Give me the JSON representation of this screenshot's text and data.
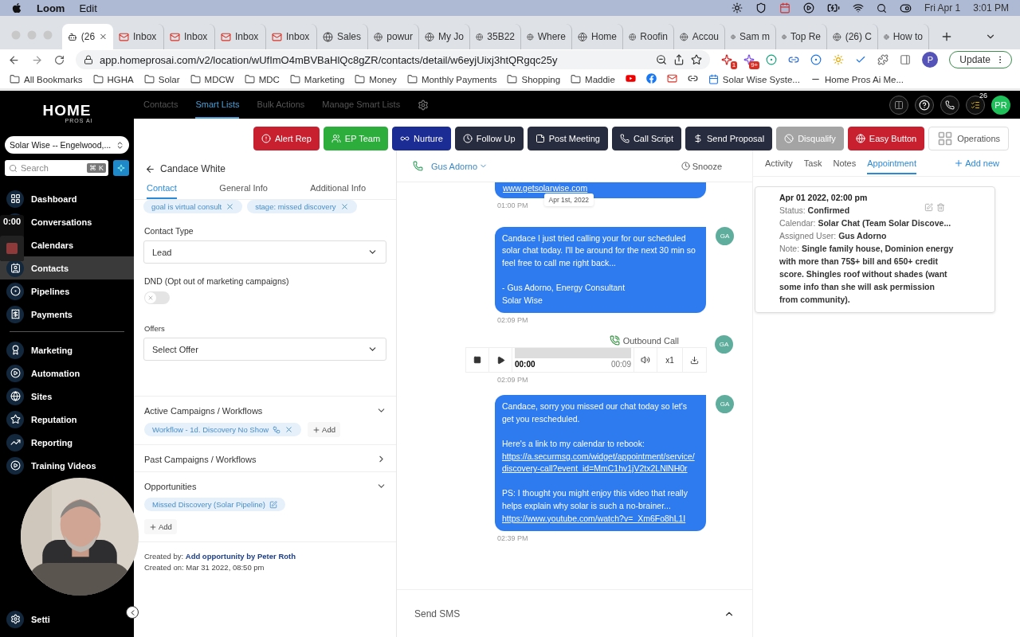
{
  "menu_bar": {
    "app": "Loom",
    "items": [
      "Edit"
    ],
    "date": "Fri Apr 1",
    "time": "3:01 PM"
  },
  "browser": {
    "tabs": [
      {
        "label": "(26",
        "selected": true
      },
      {
        "label": "Inbox",
        "selected": false
      },
      {
        "label": "Inbox",
        "selected": false
      },
      {
        "label": "Inbox",
        "selected": false
      },
      {
        "label": "Inbox",
        "selected": false
      },
      {
        "label": "Sales",
        "selected": false
      },
      {
        "label": "powur",
        "selected": false
      },
      {
        "label": "My Jo",
        "selected": false
      },
      {
        "label": "35B22",
        "selected": false
      },
      {
        "label": "Where",
        "selected": false
      },
      {
        "label": "Home",
        "selected": false
      },
      {
        "label": "Roofin",
        "selected": false
      },
      {
        "label": "Accou",
        "selected": false
      },
      {
        "label": "Sam m",
        "selected": false
      },
      {
        "label": "Top Re",
        "selected": false
      },
      {
        "label": "(26) C",
        "selected": false
      },
      {
        "label": "How to",
        "selected": false
      }
    ],
    "url": "app.homeprosai.com/v2/location/wUfImO4mBVBaHlQc8gZR/contacts/detail/w6eyjUixj3htQRgqc25y",
    "extension_badges": [
      "1",
      "9+"
    ],
    "profile": "P",
    "update_button": "Update",
    "bookmarks": [
      {
        "kind": "folder",
        "label": "All Bookmarks"
      },
      {
        "kind": "folder",
        "label": "HGHA"
      },
      {
        "kind": "folder",
        "label": "Solar"
      },
      {
        "kind": "folder",
        "label": "MDCW"
      },
      {
        "kind": "folder",
        "label": "MDC"
      },
      {
        "kind": "folder",
        "label": "Marketing"
      },
      {
        "kind": "folder",
        "label": "Money"
      },
      {
        "kind": "folder",
        "label": "Monthly Payments"
      },
      {
        "kind": "folder",
        "label": "Shopping"
      },
      {
        "kind": "folder",
        "label": "Maddie"
      },
      {
        "kind": "icon"
      },
      {
        "kind": "icon"
      },
      {
        "kind": "icon"
      },
      {
        "kind": "icon"
      },
      {
        "kind": "page",
        "label": "Solar Wise Syste..."
      },
      {
        "kind": "page",
        "label": "Home Pros Ai Me..."
      }
    ]
  },
  "app": {
    "logo": {
      "name": "HOME",
      "tagline": "PROS AI"
    },
    "location": "Solar Wise -- Engelwood,...",
    "search": {
      "placeholder": "Search",
      "shortcut": "⌘ K"
    },
    "nav_groups": [
      [
        {
          "label": "Dashboard",
          "selected": false
        },
        {
          "label": "Conversations",
          "selected": false
        },
        {
          "label": "Calendars",
          "selected": false
        },
        {
          "label": "Contacts",
          "selected": true
        },
        {
          "label": "Pipelines",
          "selected": false
        },
        {
          "label": "Payments",
          "selected": false
        }
      ],
      [
        {
          "label": "Marketing",
          "selected": false
        },
        {
          "label": "Automation",
          "selected": false
        },
        {
          "label": "Sites",
          "selected": false
        },
        {
          "label": "Reputation",
          "selected": false
        },
        {
          "label": "Reporting",
          "selected": false
        },
        {
          "label": "Training Videos",
          "selected": false
        }
      ]
    ],
    "settings": "Setti",
    "recorder_timer": "0:00",
    "top_tabs": [
      {
        "label": "Contacts",
        "selected": false
      },
      {
        "label": "Smart Lists",
        "selected": true
      },
      {
        "label": "Bulk Actions",
        "selected": false
      },
      {
        "label": "Manage Smart Lists",
        "selected": false
      }
    ],
    "task_count": "26",
    "user_initials": "PR",
    "actions": [
      {
        "label": "Alert Rep",
        "kind": "filled",
        "color": "#c8202f"
      },
      {
        "label": "EP Team",
        "kind": "filled",
        "color": "#2cad3c"
      },
      {
        "label": "Nurture",
        "kind": "filled",
        "color": "#1c2c95"
      },
      {
        "label": "Follow Up",
        "kind": "filled",
        "color": "#272c3e"
      },
      {
        "label": "Post Meeting",
        "kind": "filled",
        "color": "#272c3e"
      },
      {
        "label": "Call Script",
        "kind": "filled",
        "color": "#272c3e"
      },
      {
        "label": "Send Proposal",
        "kind": "filled",
        "color": "#272c3e"
      },
      {
        "label": "Disqualify",
        "kind": "filled",
        "color": "#a4a4a4"
      },
      {
        "label": "Easy Button",
        "kind": "filled",
        "color": "#c8202f"
      },
      {
        "label": "Operations",
        "kind": "outline",
        "color": "#ffffff"
      }
    ],
    "contact": {
      "name": "Candace White",
      "tabs": [
        {
          "label": "Contact",
          "selected": true
        },
        {
          "label": "General Info",
          "selected": false
        },
        {
          "label": "Additional Info",
          "selected": false
        }
      ],
      "tags": [
        "goal is virtual consult",
        "stage: missed discovery"
      ],
      "contact_type": {
        "label": "Contact Type",
        "value": "Lead"
      },
      "dnd": {
        "label": "DND (Opt out of marketing campaigns)",
        "on": false
      },
      "offers": {
        "label": "Offers",
        "placeholder": "Select Offer"
      },
      "sections": [
        {
          "title": "Active Campaigns / Workflows",
          "expanded": true,
          "chips": [
            "Workflow - 1d. Discovery No Show"
          ],
          "add": "Add",
          "add_inline": true
        },
        {
          "title": "Past Campaigns / Workflows",
          "expanded": false
        },
        {
          "title": "Opportunities",
          "expanded": true,
          "chips": [
            "Missed Discovery (Solar Pipeline)"
          ],
          "add": "Add",
          "add_inline": false
        }
      ],
      "created_by": {
        "label": "Created by:",
        "value": "Add opportunity by Peter Roth"
      },
      "created_on": {
        "label": "Created on:",
        "value": "Mar 31 2022, 08:50 pm"
      }
    },
    "conversation": {
      "agent": "Gus Adorno",
      "snooze": "Snooze",
      "messages": [
        {
          "kind": "sms",
          "paragraphs": [
            [
              {
                "kind": "link",
                "text": "www.getsolarwise.com"
              }
            ]
          ],
          "time": "01:00 PM",
          "date_divider": "Apr 1st, 2022"
        },
        {
          "kind": "sms",
          "avatar": "GA",
          "paragraphs": [
            [
              {
                "kind": "text",
                "text": "Candace I just tried calling your for our scheduled solar chat today. I'll be around for the next 30 min so feel free to call me right back..."
              }
            ],
            [
              {
                "kind": "text",
                "text": "- Gus Adorno, Energy Consultant\nSolar Wise"
              }
            ]
          ],
          "time": "02:09 PM"
        },
        {
          "kind": "call",
          "avatar": "GA",
          "label": "Outbound Call",
          "elapsed": "00:00",
          "duration": "00:09",
          "speed": "x1",
          "time": "02:09 PM"
        },
        {
          "kind": "sms",
          "avatar": "GA",
          "paragraphs": [
            [
              {
                "kind": "text",
                "text": "Candace, sorry you missed our chat today so let's get you rescheduled."
              }
            ],
            [
              {
                "kind": "text",
                "text": "Here's a link to my calendar to rebook:"
              },
              {
                "kind": "link",
                "text": "https://a.securmsg.com/widget/appointment/service/discovery-call?event_id=MmC1hv1jV2tx2LNlNH0r"
              }
            ],
            [
              {
                "kind": "text",
                "text": "PS: I thought you might enjoy this video that really helps explain why solar is such a no-brainer..."
              },
              {
                "kind": "link",
                "text": "https://www.youtube.com/watch?v=_Xm6Fo8hL1I"
              }
            ]
          ],
          "time": "02:39 PM"
        }
      ],
      "composer": "Send SMS"
    },
    "details": {
      "tabs": [
        {
          "label": "Activity",
          "selected": false
        },
        {
          "label": "Task",
          "selected": false
        },
        {
          "label": "Notes",
          "selected": false
        },
        {
          "label": "Appointment",
          "selected": true
        }
      ],
      "add_new": "Add new",
      "appointment": {
        "title": "Apr 01 2022, 02:00 pm",
        "fields": [
          {
            "label": "Status:",
            "value": "Confirmed"
          },
          {
            "label": "Calendar:",
            "value": "Solar Chat (Team Solar Discove..."
          },
          {
            "label": "Assigned User:",
            "value": "Gus Adorno"
          },
          {
            "label": "Note:",
            "value": "Single family house, Dominion energy with more than 75$+ bill and 650+ credit score. Shingles roof without shades (want some info than she will ask permission from community)."
          }
        ]
      }
    }
  }
}
